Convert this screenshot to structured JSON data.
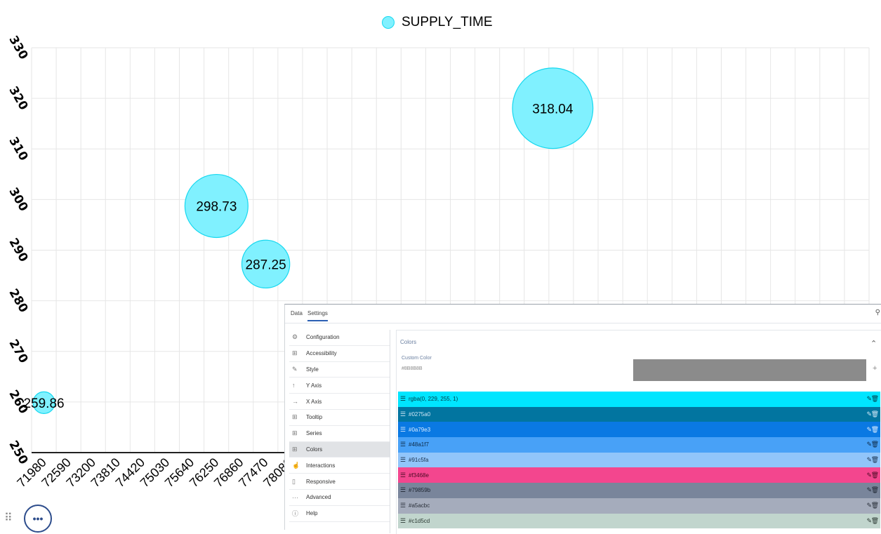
{
  "chart_data": {
    "type": "scatter",
    "series": [
      {
        "name": "SUPPLY_TIME",
        "points": [
          {
            "x": 72285,
            "y": 259.86,
            "size": 1,
            "label": "259.86"
          },
          {
            "x": 76555,
            "y": 298.73,
            "size": 2.9,
            "label": "298.73"
          },
          {
            "x": 77775,
            "y": 287.25,
            "size": 2.2,
            "label": "287.25"
          },
          {
            "x": 84875,
            "y": 318.04,
            "size": 3.7,
            "label": "318.04"
          }
        ]
      }
    ],
    "x_tick_labels": [
      "71980",
      "72590",
      "73200",
      "73810",
      "74420",
      "75030",
      "75640",
      "76250",
      "76860",
      "77470",
      "78080"
    ],
    "y_tick_labels": [
      "250",
      "260",
      "270",
      "280",
      "290",
      "300",
      "310",
      "320",
      "330"
    ],
    "xlim": [
      71980,
      84170
    ],
    "ylim": [
      250,
      330
    ],
    "grid": true,
    "legend": "top-center",
    "colors": {
      "fill": "#80f1ff",
      "stroke": "#17d8ef",
      "grid": "#e6e6e6",
      "axis": "#222222"
    }
  },
  "panel": {
    "tabs": [
      {
        "label": "Data",
        "active": false
      },
      {
        "label": "Settings",
        "active": true
      }
    ],
    "search_icon": "search-icon",
    "sidebar": [
      {
        "label": "Configuration",
        "icon": "gears-icon",
        "glyph": "⚙",
        "active": false
      },
      {
        "label": "Accessibility",
        "icon": "grid-icon",
        "glyph": "⊞",
        "active": false
      },
      {
        "label": "Style",
        "icon": "brush-icon",
        "glyph": "✎",
        "active": false
      },
      {
        "label": "Y Axis",
        "icon": "arrow-up-icon",
        "glyph": "↑",
        "active": false
      },
      {
        "label": "X Axis",
        "icon": "arrow-right-icon",
        "glyph": "→",
        "active": false
      },
      {
        "label": "Tooltip",
        "icon": "grid-icon",
        "glyph": "⊞",
        "active": false
      },
      {
        "label": "Series",
        "icon": "grid-icon",
        "glyph": "⊞",
        "active": false
      },
      {
        "label": "Colors",
        "icon": "grid-icon",
        "glyph": "⊞",
        "active": true
      },
      {
        "label": "Interactions",
        "icon": "hand-icon",
        "glyph": "☝",
        "active": false
      },
      {
        "label": "Responsive",
        "icon": "device-icon",
        "glyph": "▯",
        "active": false
      },
      {
        "label": "Advanced",
        "icon": "ellipsis-icon",
        "glyph": "···",
        "active": false
      },
      {
        "label": "Help",
        "icon": "info-icon",
        "glyph": "ⓘ",
        "active": false
      }
    ],
    "colors_section": {
      "title": "Colors",
      "custom_color_label": "Custom Color",
      "custom_color_value": "#8B8B8B",
      "custom_color_swatch": "#8b8b8b",
      "items": [
        {
          "label": "rgba(0, 229, 255, 1)",
          "bg": "#00e5ff",
          "fg": "#003a44"
        },
        {
          "label": "#0275a0",
          "bg": "#0275a0",
          "fg": "#cfe6f5"
        },
        {
          "label": "#0a79e3",
          "bg": "#0a79e3",
          "fg": "#d8ebff"
        },
        {
          "label": "#48a1f7",
          "bg": "#48a1f7",
          "fg": "#0d2a48"
        },
        {
          "label": "#91c5fa",
          "bg": "#91c5fa",
          "fg": "#1b3350"
        },
        {
          "label": "#f3468e",
          "bg": "#f3468e",
          "fg": "#4a0a24"
        },
        {
          "label": "#79859b",
          "bg": "#79859b",
          "fg": "#1d2430"
        },
        {
          "label": "#a5acbc",
          "bg": "#a5acbc",
          "fg": "#2a303a"
        },
        {
          "label": "#c1d5cd",
          "bg": "#c1d5cd",
          "fg": "#2c3a34"
        }
      ]
    }
  },
  "fab": {
    "label": "•••"
  }
}
